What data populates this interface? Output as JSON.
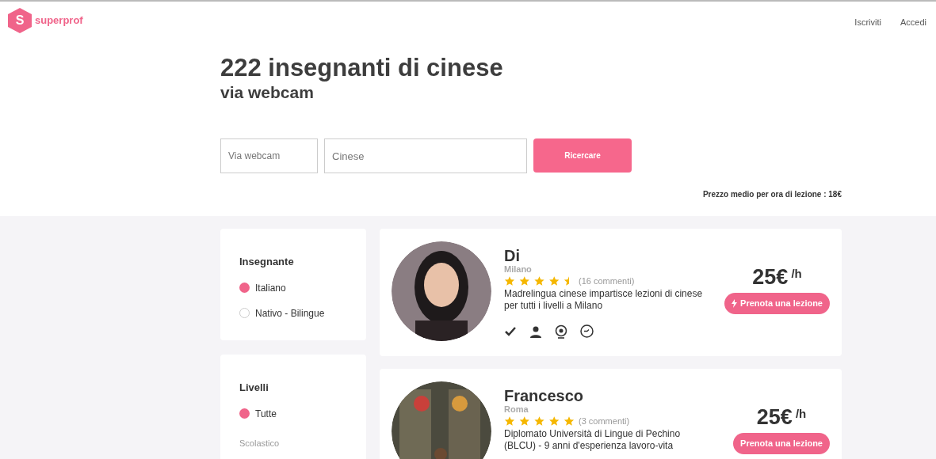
{
  "header": {
    "logo_letter": "S",
    "logo_text": "superprof",
    "nav": [
      "Iscriviti",
      "Accedi"
    ]
  },
  "title": "222 insegnanti di cinese",
  "subtitle": "via webcam",
  "search": {
    "mode_value": "Via webcam",
    "subject_value": "Cinese",
    "button": "Ricercare"
  },
  "average_price": "Prezzo medio per ora di lezione : 18€",
  "filters": [
    {
      "title": "Insegnante",
      "options": [
        {
          "label": "Italiano",
          "selected": true
        },
        {
          "label": "Nativo - Bilingue",
          "selected": false
        }
      ]
    },
    {
      "title": "Livelli",
      "options": [
        {
          "label": "Tutte",
          "selected": true
        }
      ],
      "group_label": "Scolastico"
    }
  ],
  "teachers": [
    {
      "name": "Di",
      "city": "Milano",
      "stars": 4.5,
      "reviews": "(16 commenti)",
      "description": "Madrelingua cinese impartisce lezioni di cinese per tutti i livelli a Milano",
      "price": "25€",
      "unit": "/h",
      "button": "Prenota una lezione",
      "instant_booking": true,
      "badges": true
    },
    {
      "name": "Francesco",
      "city": "Roma",
      "stars": 5,
      "reviews": "(3 commenti)",
      "description": "Diplomato Università di Lingue di Pechino (BLCU) - 9 anni d'esperienza lavoro-vita",
      "price": "25€",
      "unit": "/h",
      "button": "Prenota una lezione",
      "instant_booking": false
    }
  ]
}
